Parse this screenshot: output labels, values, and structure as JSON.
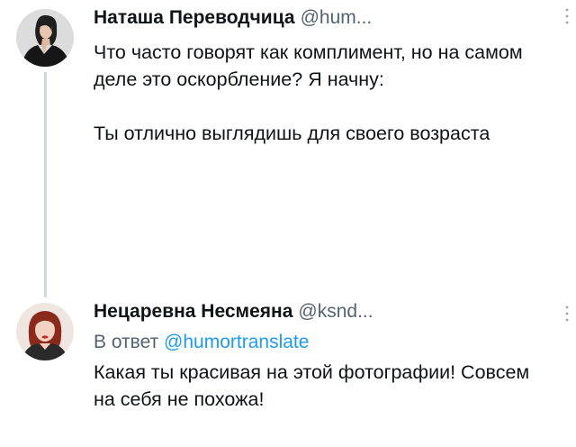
{
  "tweets": [
    {
      "display_name": "Наташа Переводчица",
      "handle": "@hum...",
      "text": "Что часто говорят как комплимент, но на самом деле это оскорбление? Я начну:\n\nТы отлично выглядишь для своего возраста"
    },
    {
      "display_name": "Нецаревна Несмеяна",
      "handle": "@ksnd...",
      "reply_prefix": "В ответ",
      "reply_mention": "@humortranslate",
      "text": "Какая ты красивая на этой фотографии! Совсем на себя не похожа!"
    }
  ],
  "colors": {
    "text": "#0f1419",
    "secondary": "#536471",
    "accent": "#1d9bf0",
    "thread_line": "#cfd9de"
  },
  "icons": {
    "more": "more-vertical-icon"
  }
}
